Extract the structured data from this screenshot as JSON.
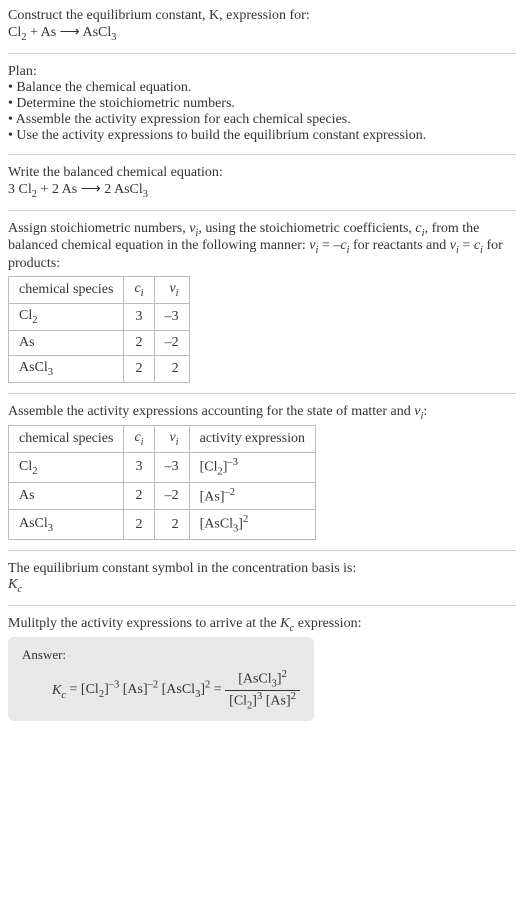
{
  "header": {
    "prompt": "Construct the equilibrium constant, K, expression for:",
    "equation_html": "Cl<sub>2</sub> + As ⟶ AsCl<sub>3</sub>"
  },
  "plan": {
    "title": "Plan:",
    "items": [
      "• Balance the chemical equation.",
      "• Determine the stoichiometric numbers.",
      "• Assemble the activity expression for each chemical species.",
      "• Use the activity expressions to build the equilibrium constant expression."
    ]
  },
  "balanced": {
    "intro": "Write the balanced chemical equation:",
    "equation_html": "3 Cl<sub>2</sub> + 2 As ⟶ 2 AsCl<sub>3</sub>"
  },
  "stoich": {
    "intro_html": "Assign stoichiometric numbers, <span class=\"italic\">ν<sub>i</sub></span>, using the stoichiometric coefficients, <span class=\"italic\">c<sub>i</sub></span>, from the balanced chemical equation in the following manner: <span class=\"italic\">ν<sub>i</sub></span> = –<span class=\"italic\">c<sub>i</sub></span> for reactants and <span class=\"italic\">ν<sub>i</sub></span> = <span class=\"italic\">c<sub>i</sub></span> for products:",
    "headers": {
      "species": "chemical species",
      "ci_html": "<span class=\"italic\">c<sub>i</sub></span>",
      "vi_html": "<span class=\"italic\">ν<sub>i</sub></span>"
    },
    "rows": [
      {
        "species_html": "Cl<sub>2</sub>",
        "ci": "3",
        "vi": "–3"
      },
      {
        "species_html": "As",
        "ci": "2",
        "vi": "–2"
      },
      {
        "species_html": "AsCl<sub>3</sub>",
        "ci": "2",
        "vi": "2"
      }
    ]
  },
  "activity": {
    "intro_html": "Assemble the activity expressions accounting for the state of matter and <span class=\"italic\">ν<sub>i</sub></span>:",
    "headers": {
      "species": "chemical species",
      "ci_html": "<span class=\"italic\">c<sub>i</sub></span>",
      "vi_html": "<span class=\"italic\">ν<sub>i</sub></span>",
      "act": "activity expression"
    },
    "rows": [
      {
        "species_html": "Cl<sub>2</sub>",
        "ci": "3",
        "vi": "–3",
        "act_html": "[Cl<sub>2</sub>]<sup>–3</sup>"
      },
      {
        "species_html": "As",
        "ci": "2",
        "vi": "–2",
        "act_html": "[As]<sup>–2</sup>"
      },
      {
        "species_html": "AsCl<sub>3</sub>",
        "ci": "2",
        "vi": "2",
        "act_html": "[AsCl<sub>3</sub>]<sup>2</sup>"
      }
    ]
  },
  "symbol": {
    "intro": "The equilibrium constant symbol in the concentration basis is:",
    "kc_html": "<span class=\"italic\">K<sub>c</sub></span>"
  },
  "multiply": {
    "intro_html": "Mulitply the activity expressions to arrive at the <span class=\"italic\">K<sub>c</sub></span> expression:"
  },
  "answer": {
    "label": "Answer:",
    "expr_html": "<span class=\"italic\">K<sub>c</sub></span> = [Cl<sub>2</sub>]<sup>–3</sup> [As]<sup>–2</sup> [AsCl<sub>3</sub>]<sup>2</sup> = <span class=\"frac\"><span class=\"num\">[AsCl<sub>3</sub>]<sup>2</sup></span><span class=\"den\">[Cl<sub>2</sub>]<sup>3</sup> [As]<sup>2</sup></span></span>"
  }
}
